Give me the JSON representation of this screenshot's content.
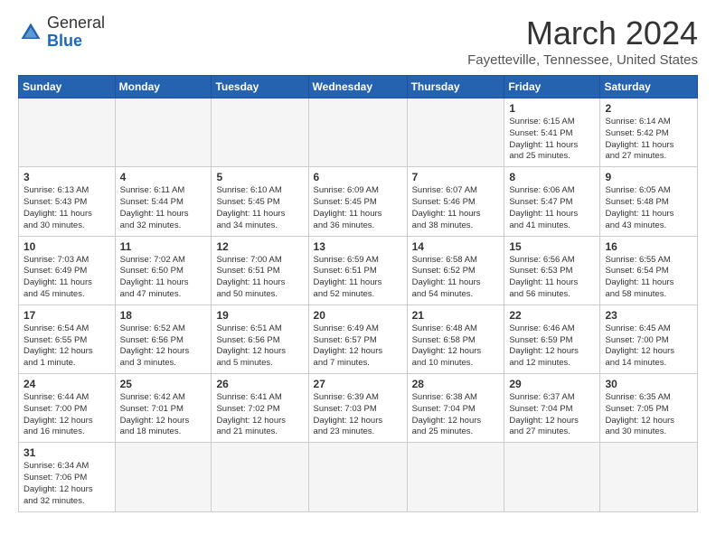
{
  "header": {
    "logo_line1": "General",
    "logo_line2": "Blue",
    "month_year": "March 2024",
    "location": "Fayetteville, Tennessee, United States"
  },
  "weekdays": [
    "Sunday",
    "Monday",
    "Tuesday",
    "Wednesday",
    "Thursday",
    "Friday",
    "Saturday"
  ],
  "weeks": [
    [
      {
        "day": "",
        "text": ""
      },
      {
        "day": "",
        "text": ""
      },
      {
        "day": "",
        "text": ""
      },
      {
        "day": "",
        "text": ""
      },
      {
        "day": "",
        "text": ""
      },
      {
        "day": "1",
        "text": "Sunrise: 6:15 AM\nSunset: 5:41 PM\nDaylight: 11 hours\nand 25 minutes."
      },
      {
        "day": "2",
        "text": "Sunrise: 6:14 AM\nSunset: 5:42 PM\nDaylight: 11 hours\nand 27 minutes."
      }
    ],
    [
      {
        "day": "3",
        "text": "Sunrise: 6:13 AM\nSunset: 5:43 PM\nDaylight: 11 hours\nand 30 minutes."
      },
      {
        "day": "4",
        "text": "Sunrise: 6:11 AM\nSunset: 5:44 PM\nDaylight: 11 hours\nand 32 minutes."
      },
      {
        "day": "5",
        "text": "Sunrise: 6:10 AM\nSunset: 5:45 PM\nDaylight: 11 hours\nand 34 minutes."
      },
      {
        "day": "6",
        "text": "Sunrise: 6:09 AM\nSunset: 5:45 PM\nDaylight: 11 hours\nand 36 minutes."
      },
      {
        "day": "7",
        "text": "Sunrise: 6:07 AM\nSunset: 5:46 PM\nDaylight: 11 hours\nand 38 minutes."
      },
      {
        "day": "8",
        "text": "Sunrise: 6:06 AM\nSunset: 5:47 PM\nDaylight: 11 hours\nand 41 minutes."
      },
      {
        "day": "9",
        "text": "Sunrise: 6:05 AM\nSunset: 5:48 PM\nDaylight: 11 hours\nand 43 minutes."
      }
    ],
    [
      {
        "day": "10",
        "text": "Sunrise: 7:03 AM\nSunset: 6:49 PM\nDaylight: 11 hours\nand 45 minutes."
      },
      {
        "day": "11",
        "text": "Sunrise: 7:02 AM\nSunset: 6:50 PM\nDaylight: 11 hours\nand 47 minutes."
      },
      {
        "day": "12",
        "text": "Sunrise: 7:00 AM\nSunset: 6:51 PM\nDaylight: 11 hours\nand 50 minutes."
      },
      {
        "day": "13",
        "text": "Sunrise: 6:59 AM\nSunset: 6:51 PM\nDaylight: 11 hours\nand 52 minutes."
      },
      {
        "day": "14",
        "text": "Sunrise: 6:58 AM\nSunset: 6:52 PM\nDaylight: 11 hours\nand 54 minutes."
      },
      {
        "day": "15",
        "text": "Sunrise: 6:56 AM\nSunset: 6:53 PM\nDaylight: 11 hours\nand 56 minutes."
      },
      {
        "day": "16",
        "text": "Sunrise: 6:55 AM\nSunset: 6:54 PM\nDaylight: 11 hours\nand 58 minutes."
      }
    ],
    [
      {
        "day": "17",
        "text": "Sunrise: 6:54 AM\nSunset: 6:55 PM\nDaylight: 12 hours\nand 1 minute."
      },
      {
        "day": "18",
        "text": "Sunrise: 6:52 AM\nSunset: 6:56 PM\nDaylight: 12 hours\nand 3 minutes."
      },
      {
        "day": "19",
        "text": "Sunrise: 6:51 AM\nSunset: 6:56 PM\nDaylight: 12 hours\nand 5 minutes."
      },
      {
        "day": "20",
        "text": "Sunrise: 6:49 AM\nSunset: 6:57 PM\nDaylight: 12 hours\nand 7 minutes."
      },
      {
        "day": "21",
        "text": "Sunrise: 6:48 AM\nSunset: 6:58 PM\nDaylight: 12 hours\nand 10 minutes."
      },
      {
        "day": "22",
        "text": "Sunrise: 6:46 AM\nSunset: 6:59 PM\nDaylight: 12 hours\nand 12 minutes."
      },
      {
        "day": "23",
        "text": "Sunrise: 6:45 AM\nSunset: 7:00 PM\nDaylight: 12 hours\nand 14 minutes."
      }
    ],
    [
      {
        "day": "24",
        "text": "Sunrise: 6:44 AM\nSunset: 7:00 PM\nDaylight: 12 hours\nand 16 minutes."
      },
      {
        "day": "25",
        "text": "Sunrise: 6:42 AM\nSunset: 7:01 PM\nDaylight: 12 hours\nand 18 minutes."
      },
      {
        "day": "26",
        "text": "Sunrise: 6:41 AM\nSunset: 7:02 PM\nDaylight: 12 hours\nand 21 minutes."
      },
      {
        "day": "27",
        "text": "Sunrise: 6:39 AM\nSunset: 7:03 PM\nDaylight: 12 hours\nand 23 minutes."
      },
      {
        "day": "28",
        "text": "Sunrise: 6:38 AM\nSunset: 7:04 PM\nDaylight: 12 hours\nand 25 minutes."
      },
      {
        "day": "29",
        "text": "Sunrise: 6:37 AM\nSunset: 7:04 PM\nDaylight: 12 hours\nand 27 minutes."
      },
      {
        "day": "30",
        "text": "Sunrise: 6:35 AM\nSunset: 7:05 PM\nDaylight: 12 hours\nand 30 minutes."
      }
    ],
    [
      {
        "day": "31",
        "text": "Sunrise: 6:34 AM\nSunset: 7:06 PM\nDaylight: 12 hours\nand 32 minutes."
      },
      {
        "day": "",
        "text": ""
      },
      {
        "day": "",
        "text": ""
      },
      {
        "day": "",
        "text": ""
      },
      {
        "day": "",
        "text": ""
      },
      {
        "day": "",
        "text": ""
      },
      {
        "day": "",
        "text": ""
      }
    ]
  ]
}
